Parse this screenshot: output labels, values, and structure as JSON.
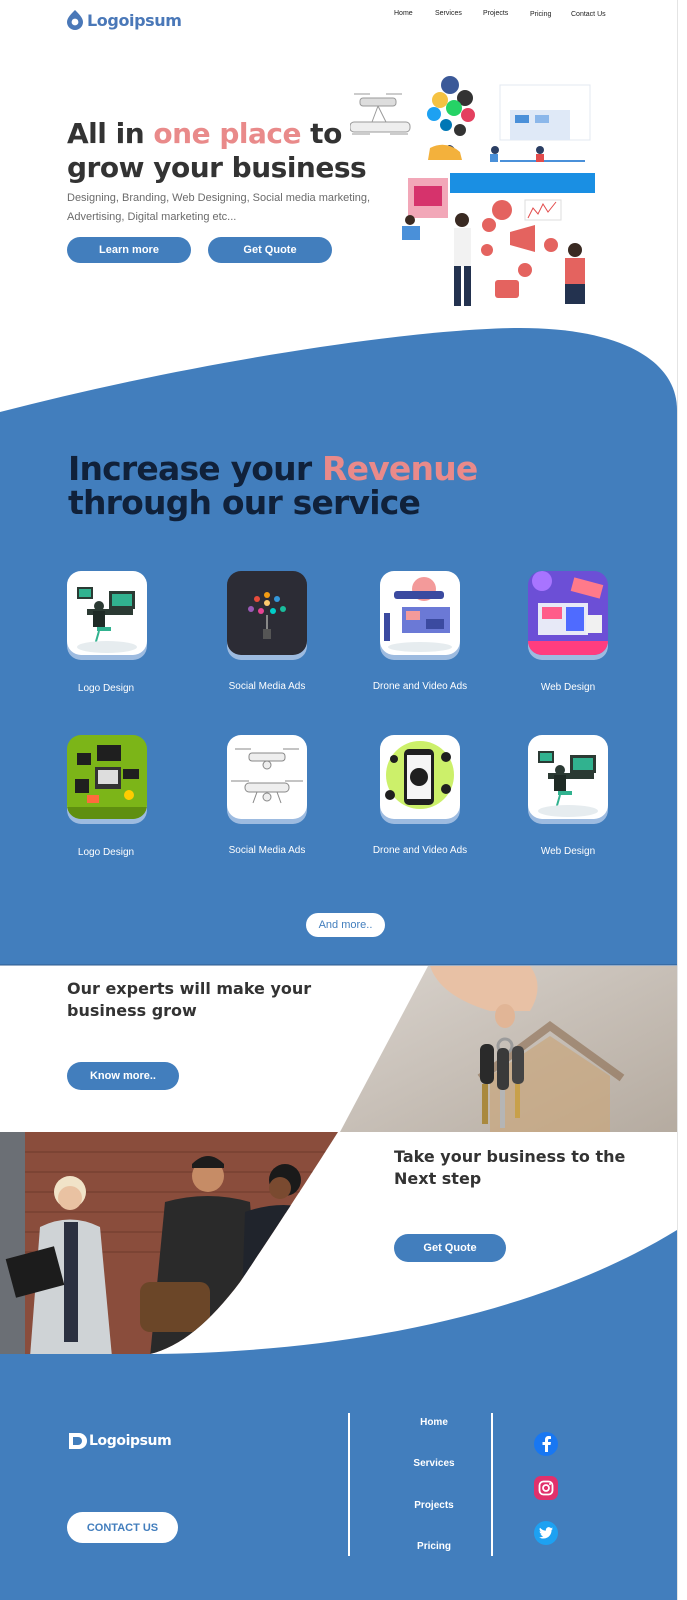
{
  "brand": {
    "name": "Logoipsum"
  },
  "nav": {
    "items": [
      "Home",
      "Services",
      "Projects",
      "Pricing",
      "Contact Us"
    ]
  },
  "hero": {
    "title_part1": "All in ",
    "title_highlight": "one place",
    "title_part2": " to grow your business",
    "subtitle": "Designing, Branding, Web Designing, Social media marketing, Advertising, Digital marketing etc...",
    "learn_more": "Learn more",
    "get_quote": "Get Quote"
  },
  "services": {
    "title_part1": "Increase your ",
    "title_highlight": "Revenue",
    "title_part2": "through our service",
    "items": [
      {
        "label": "Logo Design"
      },
      {
        "label": "Social Media Ads"
      },
      {
        "label": "Drone and Video Ads"
      },
      {
        "label": "Web Design"
      },
      {
        "label": "Logo Design"
      },
      {
        "label": "Social Media Ads"
      },
      {
        "label": "Drone and Video Ads"
      },
      {
        "label": "Web Design"
      }
    ],
    "more_button": "And more.."
  },
  "experts": {
    "title": "Our experts will make your business grow",
    "button": "Know more.."
  },
  "next_step": {
    "title": "Take your business to the Next step",
    "button": "Get Quote"
  },
  "footer": {
    "contact_button": "CONTACT US",
    "links": [
      "Home",
      "Services",
      "Projects",
      "Pricing"
    ],
    "social": [
      "facebook-icon",
      "instagram-icon",
      "twitter-icon"
    ]
  },
  "colors": {
    "primary": "#427ebd",
    "accent": "#e98a8a",
    "dark": "#10213a"
  }
}
